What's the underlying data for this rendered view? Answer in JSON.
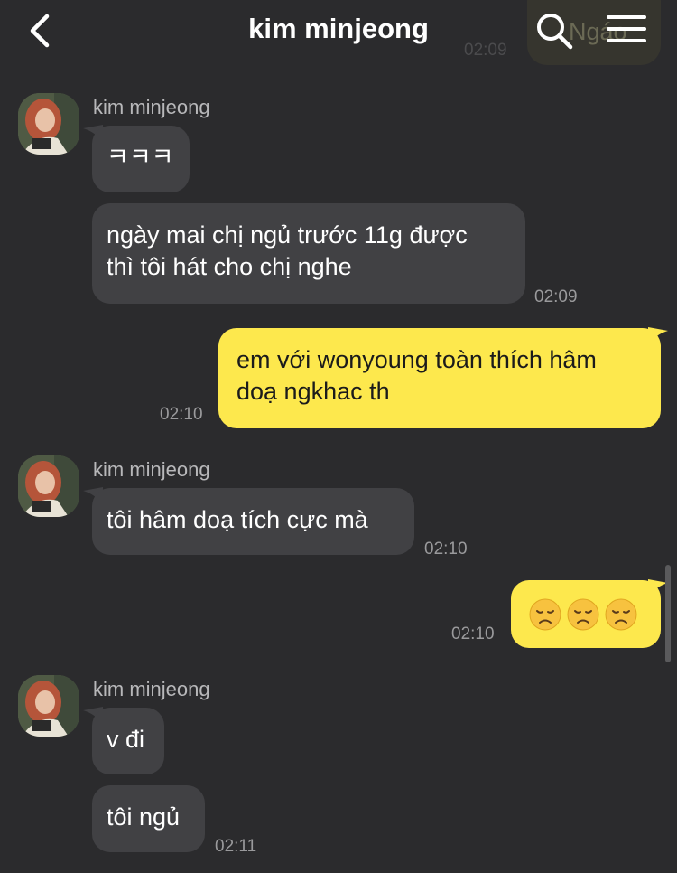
{
  "header": {
    "title": "kim minjeong",
    "back_icon": "chevron-left-icon",
    "search_icon": "search-icon",
    "menu_icon": "hamburger-menu-icon"
  },
  "peek_message": {
    "text": "Ngáo",
    "time": "02:09"
  },
  "messages": [
    {
      "direction": "in",
      "sender": "kim minjeong",
      "text": "ㅋㅋㅋ"
    },
    {
      "direction": "in",
      "text": "ngày mai chị ngủ trước 11g được thì tôi hát cho chị nghe",
      "line1": "ngày mai chị ngủ trước 11g được",
      "line2": "thì tôi hát cho chị nghe",
      "time": "02:09"
    },
    {
      "direction": "out",
      "text": "em với wonyoung toàn thích hâm doạ ngkhac th",
      "line1": "em với wonyoung toàn thích hâm",
      "line2": "doạ ngkhac th",
      "time": "02:10"
    },
    {
      "direction": "in",
      "sender": "kim minjeong",
      "text": "tôi hâm doạ tích cực mà",
      "time": "02:10"
    },
    {
      "direction": "out",
      "emoji": [
        "disappointed-face",
        "disappointed-face",
        "disappointed-face"
      ],
      "time": "02:10"
    },
    {
      "direction": "in",
      "sender": "kim minjeong",
      "text": "v đi"
    },
    {
      "direction": "in",
      "text": "tôi ngủ",
      "time": "02:11"
    }
  ],
  "colors": {
    "background": "#2b2b2d",
    "incoming_bubble": "#414144",
    "outgoing_bubble": "#fde84d",
    "timestamp": "#9a9a9c"
  }
}
